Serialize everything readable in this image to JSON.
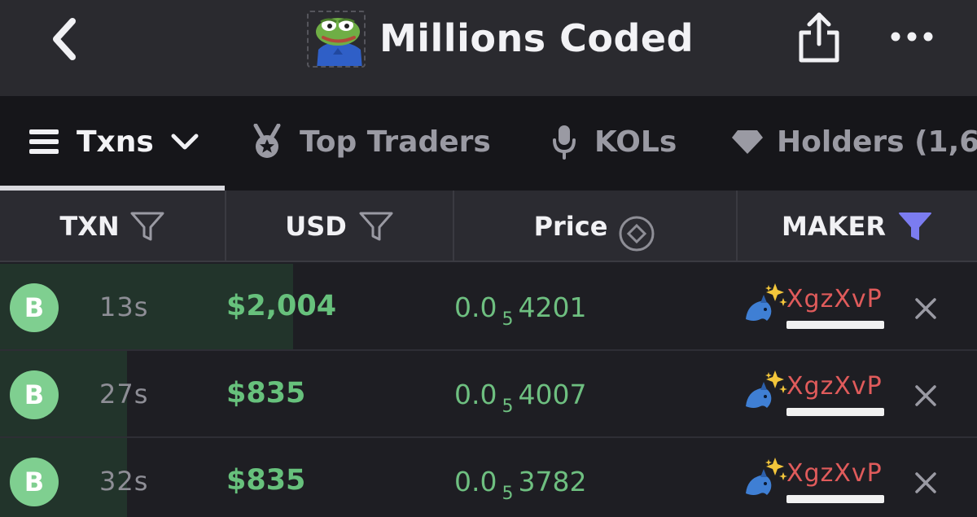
{
  "header": {
    "title": "Millions Coded",
    "token_icon": "frog-avatar-icon",
    "back_icon": "chevron-left-icon",
    "share_icon": "share-icon",
    "more_icon": "more-dots-icon"
  },
  "tabs": [
    {
      "label": "Txns",
      "icon": "list-icon",
      "active": true
    },
    {
      "label": "Top Traders",
      "icon": "medal-icon"
    },
    {
      "label": "KOLs",
      "icon": "microphone-icon"
    },
    {
      "label": "Holders (1,6",
      "icon": "diamond-icon"
    }
  ],
  "columns": {
    "txn": "TXN",
    "usd": "USD",
    "price": "Price",
    "maker": "MAKER"
  },
  "rows": [
    {
      "type": "B",
      "age": "13s",
      "usd": "$2,004",
      "price_lead": "0.0",
      "price_zeros": "5",
      "price_digits": "4201",
      "maker": "XgzXvP",
      "fill": 0.3
    },
    {
      "type": "B",
      "age": "27s",
      "usd": "$835",
      "price_lead": "0.0",
      "price_zeros": "5",
      "price_digits": "4007",
      "maker": "XgzXvP",
      "fill": 0.13
    },
    {
      "type": "B",
      "age": "32s",
      "usd": "$835",
      "price_lead": "0.0",
      "price_zeros": "5",
      "price_digits": "3782",
      "maker": "XgzXvP",
      "fill": 0.13
    }
  ],
  "colors": {
    "buy_green": "#67c17c",
    "maker_red": "#e05b5b",
    "filter_active": "#7b7cf0",
    "background": "#1e1e23"
  }
}
